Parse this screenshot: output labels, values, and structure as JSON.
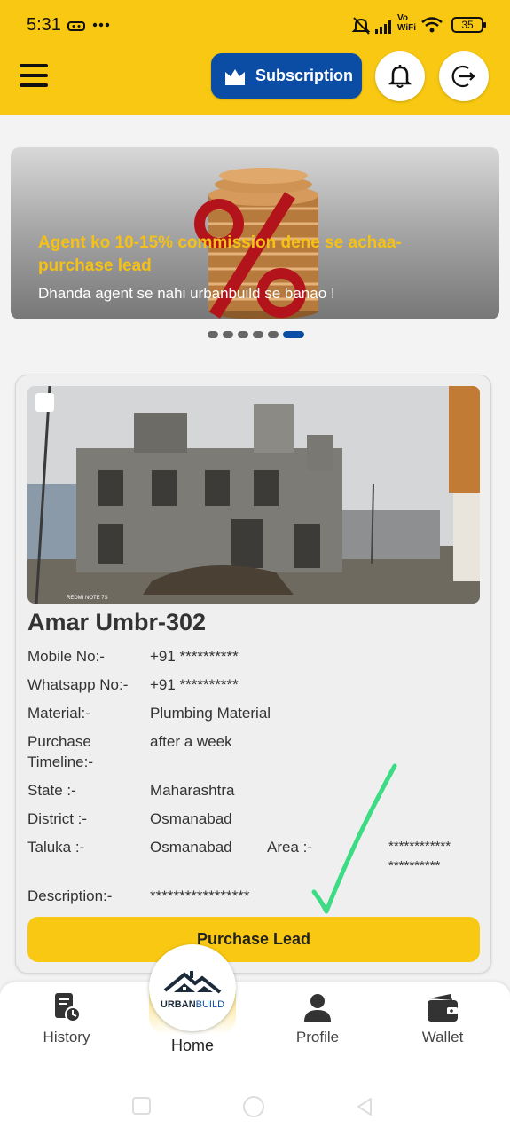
{
  "status_bar": {
    "time": "5:31",
    "battery": "35",
    "net_label_top": "Vo",
    "net_label_bottom": "WiFi"
  },
  "header": {
    "subscription_label": "Subscription",
    "icons": [
      "menu-icon",
      "crown-icon",
      "bell-icon",
      "logout-icon"
    ]
  },
  "banner": {
    "title": "Agent ko 10-15% commission dene se achaa-purchase lead",
    "subtitle": "Dhanda agent se nahi urbanbuild se banao !",
    "slide_count": 6,
    "active_slide": 6
  },
  "lead": {
    "name": "Amar Umbr-302",
    "photo_caption": "REDMI NOTE 7S",
    "fields": {
      "mobile_label": "Mobile No:-",
      "mobile_value": "+91  **********",
      "whatsapp_label": "Whatsapp No:-",
      "whatsapp_value": "+91  **********",
      "material_label": "Material:-",
      "material_value": "Plumbing  Material",
      "timeline_label_1": "Purchase",
      "timeline_label_2": "Timeline:-",
      "timeline_value": "after a week",
      "state_label": "State :-",
      "state_value": "Maharashtra",
      "district_label": "District :-",
      "district_value": "Osmanabad",
      "taluka_label": "Taluka :-",
      "taluka_value": "Osmanabad",
      "area_label": "Area :-",
      "area_value_1": "************",
      "area_value_2": "**********",
      "description_label": "Description:-",
      "description_value": "*****************"
    },
    "purchase_label": "Purchase Lead"
  },
  "bottom_nav": {
    "history": "History",
    "home": "Home",
    "profile": "Profile",
    "wallet": "Wallet",
    "logo_text_1": "URBAN",
    "logo_text_2": "BUILD"
  },
  "colors": {
    "brand_yellow": "#f8c812",
    "brand_blue": "#0b4da5",
    "check_green": "#3ddc84"
  }
}
